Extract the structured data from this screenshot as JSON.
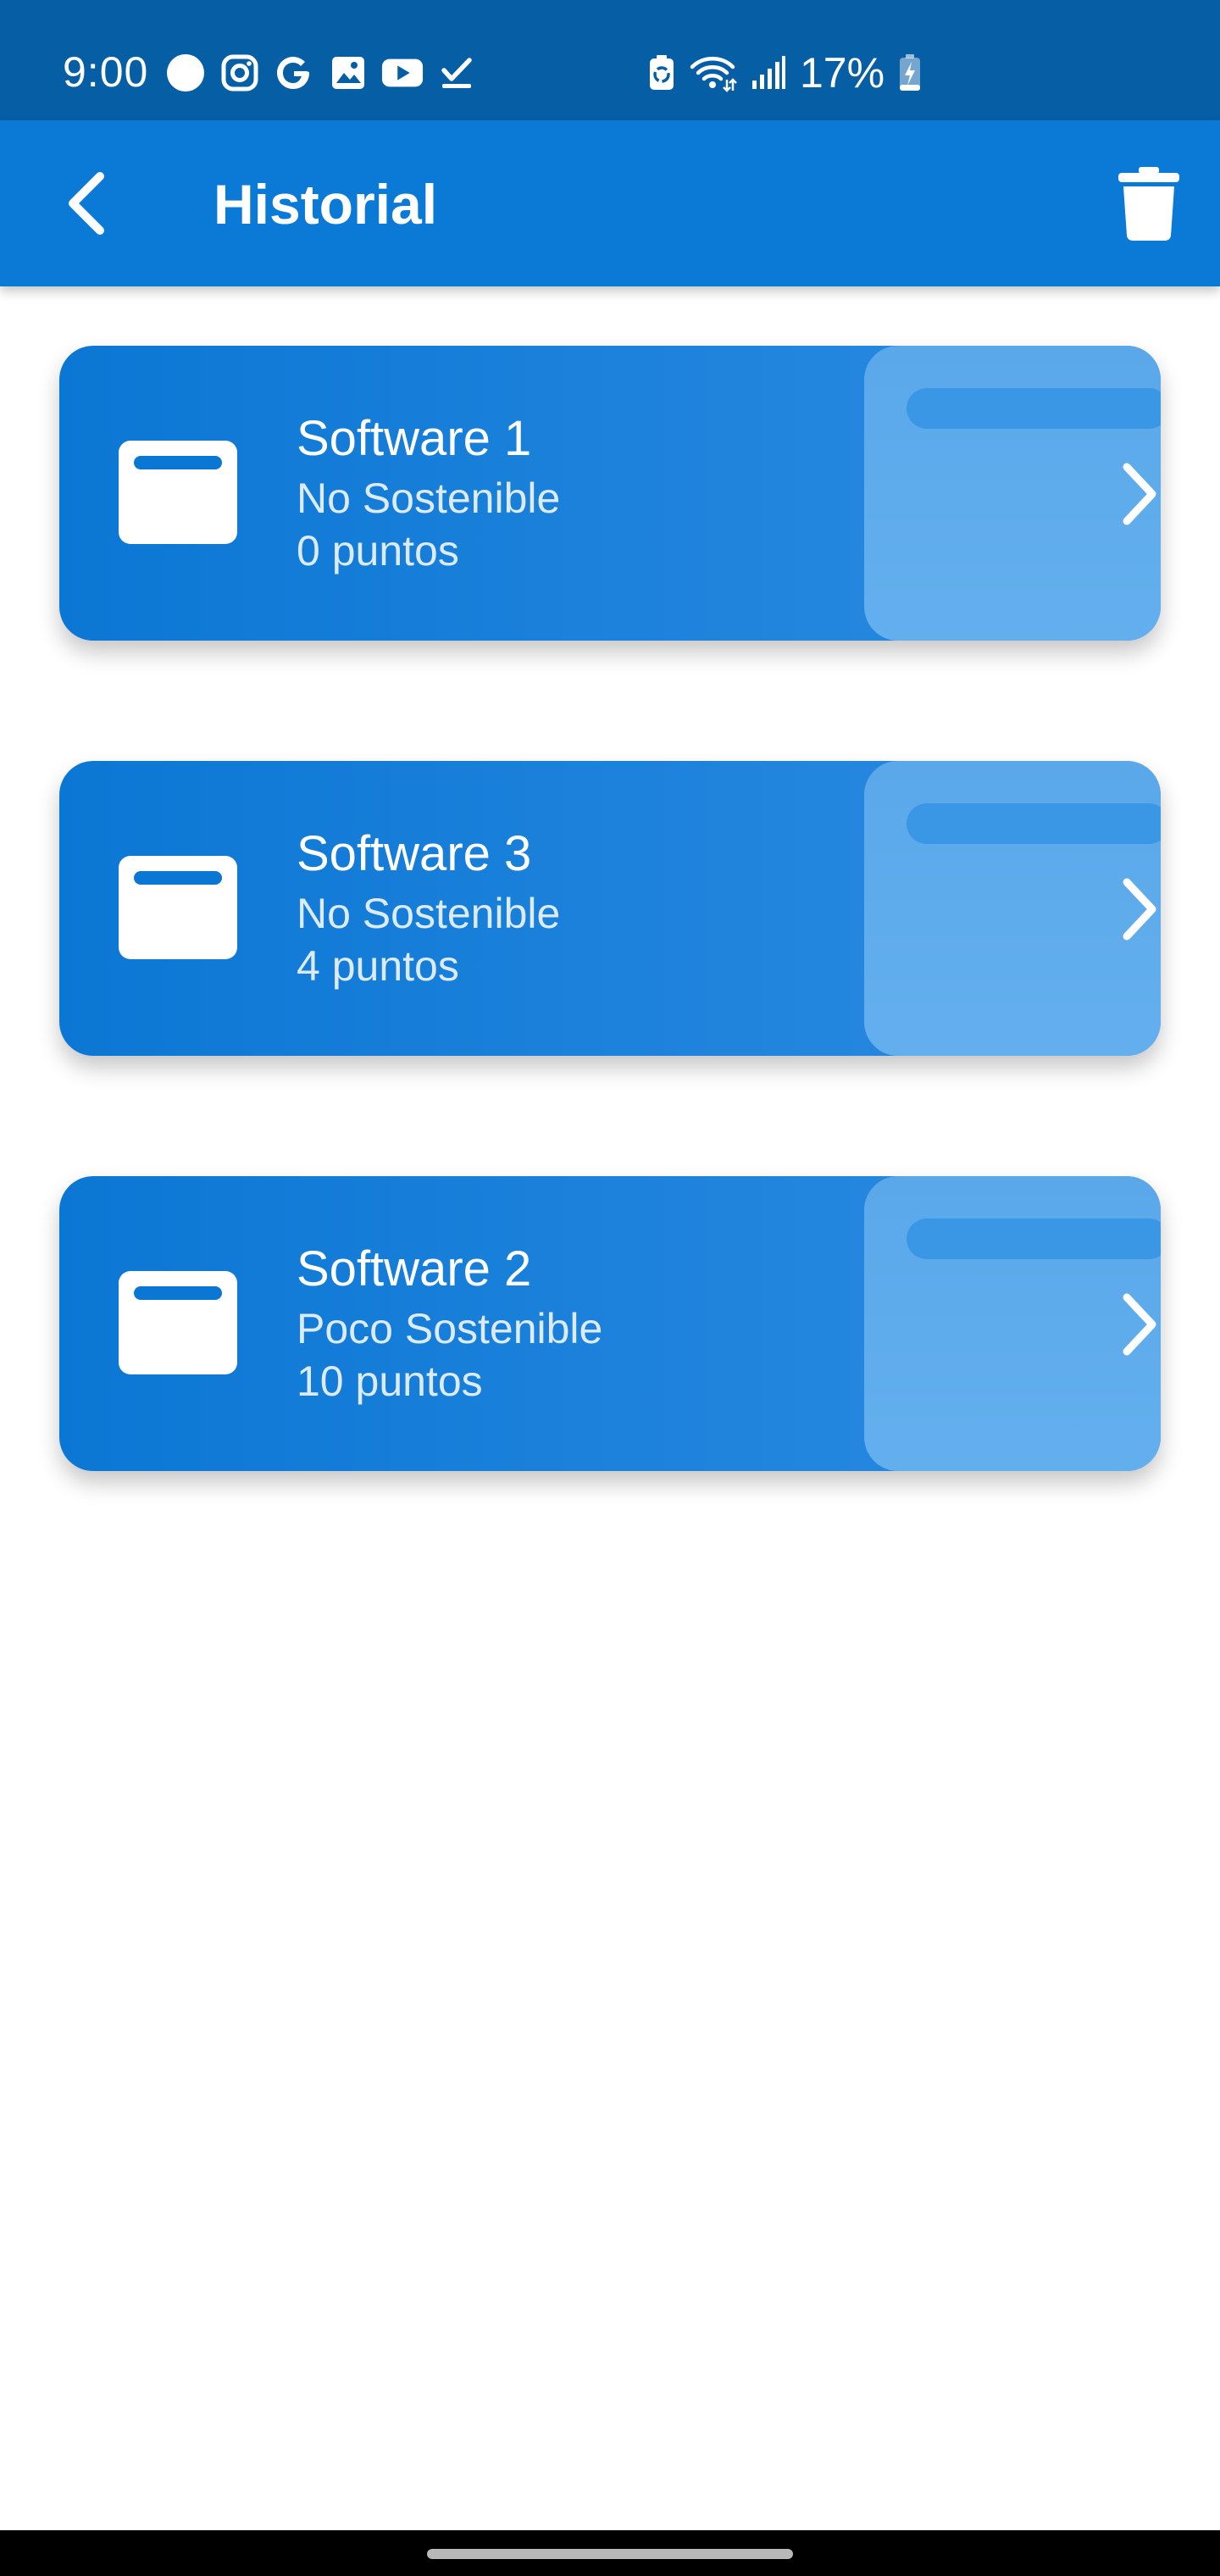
{
  "status_bar": {
    "time": "9:00",
    "battery": "17%",
    "left_icons": [
      "notification-dot-icon",
      "instagram-icon",
      "google-icon",
      "gallery-icon",
      "youtube-icon",
      "task-check-icon"
    ],
    "right_icons": [
      "battery-saver-icon",
      "wifi-icon",
      "signal-icon",
      "battery-charging-icon"
    ]
  },
  "app_bar": {
    "title": "Historial",
    "back_icon": "chevron-left-icon",
    "delete_icon": "trash-icon"
  },
  "history": {
    "items": [
      {
        "title": "Software 1",
        "status": "No Sostenible",
        "points": "0 puntos"
      },
      {
        "title": "Software 3",
        "status": "No Sostenible",
        "points": "4 puntos"
      },
      {
        "title": "Software 2",
        "status": "Poco Sostenible",
        "points": "10 puntos"
      }
    ]
  },
  "colors": {
    "status_bar": "#065ea5",
    "app_bar": "#0b7ad6",
    "card_primary": "#0b77d4",
    "card_accent": "#5aa8ea",
    "text_light": "#ffffff",
    "text_secondary": "#dcebfa"
  }
}
